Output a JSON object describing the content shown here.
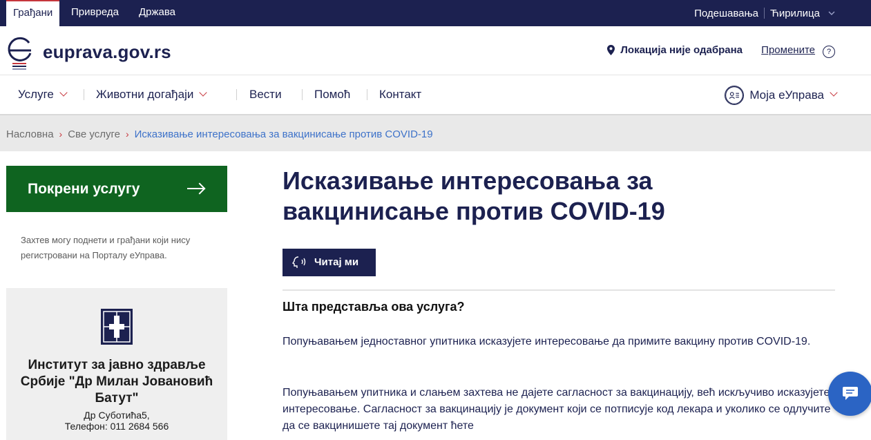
{
  "topbar": {
    "tabs": [
      {
        "label": "Грађани",
        "active": true
      },
      {
        "label": "Привреда",
        "active": false
      },
      {
        "label": "Држава",
        "active": false
      }
    ],
    "settings_label": "Подешавања",
    "language_label": "Ћирилица"
  },
  "header": {
    "logo_text": "euprava.gov.rs",
    "location_text": "Локација није одабрана",
    "change_label": "Промените",
    "help_icon": "?"
  },
  "nav": {
    "items": [
      {
        "label": "Услуге",
        "dropdown": true
      },
      {
        "label": "Животни догађаји",
        "dropdown": true
      },
      {
        "label": "Вести",
        "dropdown": false
      },
      {
        "label": "Помоћ",
        "dropdown": false
      },
      {
        "label": "Контакт",
        "dropdown": false
      }
    ],
    "account_label": "Моја еУправа"
  },
  "breadcrumb": {
    "items": [
      "Насловна",
      "Све услуге"
    ],
    "current": "Исказивање интересовања за вакцинисање против COVID-19"
  },
  "sidebar": {
    "start_button_label": "Покрени услугу",
    "note": "Захтев могу поднети и грађани који нису регистровани на Порталу еУправа.",
    "institution": {
      "name": "Институт за јавно здравље Србије \"Др Милан Јовановић Батут\"",
      "address": "Др Суботића5,",
      "phone": "Телефон: 011 2684 566"
    }
  },
  "main": {
    "title": "Исказивање интересовања за вакцинисање против COVID-19",
    "read_button_label": "Читај ми",
    "section_heading": "Шта представља ова услуга?",
    "paragraph1": "Попуњавањем једноставног упитника исказујете интересовање да примите вакцину против COVID-19.",
    "paragraph2": "Попуњавањем упитника и слањем захтева не дајете сагласност за вакцинацију, већ искључиво исказујете интересовање. Сагласност за вакцинацију је документ који се потписује код лекара и уколико се одлучите да се вакцинишете тај документ ћете"
  },
  "colors": {
    "primary": "#1c2150",
    "accent_red": "#c6363c",
    "start_green": "#0f6420",
    "link_blue": "#3d72c9",
    "chat_blue": "#2b64c4"
  },
  "icons": {
    "location": "map-pin-icon",
    "help": "question-circle-icon",
    "account": "user-card-icon",
    "read": "speaker-head-icon",
    "chat": "chat-bubble-icon"
  }
}
